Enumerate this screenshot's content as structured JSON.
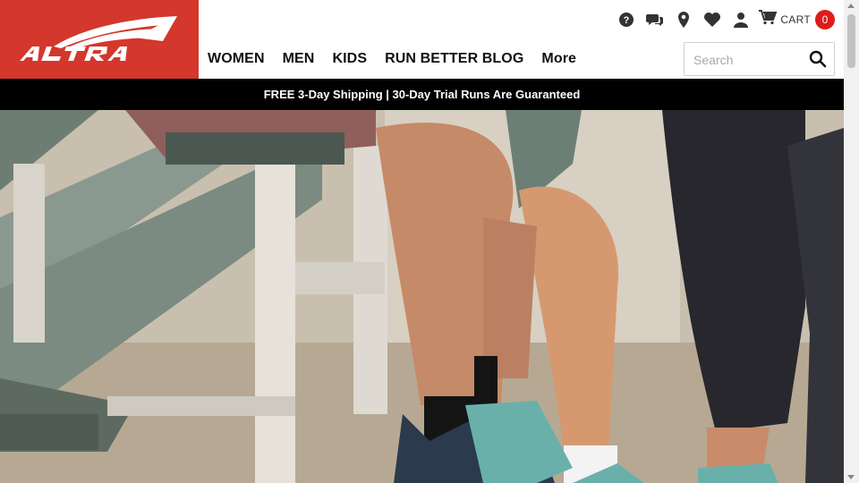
{
  "brand": {
    "logo_text": "ALTRA",
    "accent": "#d4372c"
  },
  "nav": {
    "items": [
      {
        "label": "WOMEN"
      },
      {
        "label": "MEN"
      },
      {
        "label": "KIDS"
      },
      {
        "label": "RUN BETTER BLOG"
      },
      {
        "label": "More"
      }
    ]
  },
  "utilities": {
    "icons": [
      "help-icon",
      "chat-icon",
      "location-pin-icon",
      "heart-icon",
      "account-icon"
    ],
    "cart": {
      "label": "CART",
      "count": "0",
      "icon": "cart-icon"
    }
  },
  "search": {
    "placeholder": "Search",
    "value": ""
  },
  "promo": {
    "text": "FREE 3-Day Shipping | 30-Day Trial Runs Are Guaranteed"
  },
  "hero": {
    "description_icon": "hero-image"
  }
}
